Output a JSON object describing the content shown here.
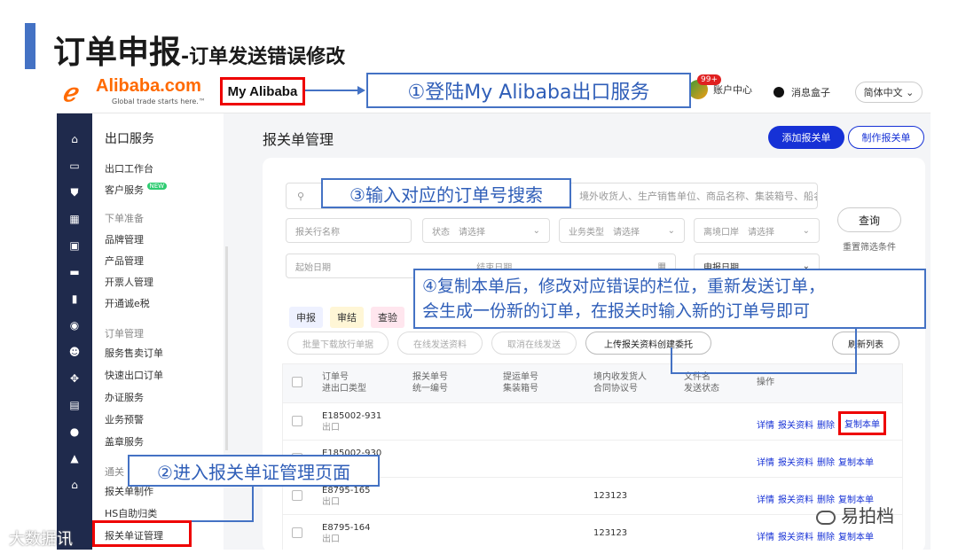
{
  "slide": {
    "title": "订单申报",
    "subtitle": "-订单发送错误修改"
  },
  "header": {
    "logo_text": "Alibaba.com",
    "logo_tagline": "Global trade starts here.™",
    "my_alibaba": "My Alibaba",
    "badge": "99+",
    "account_center": "账户中心",
    "message_box": "消息盒子",
    "language": "简体中文 ⌄"
  },
  "sidebar": {
    "title": "出口服务",
    "items": [
      {
        "label": "出口工作台"
      },
      {
        "label": "客户服务",
        "tag": "NEW"
      },
      {
        "group": "下单准备"
      },
      {
        "label": "品牌管理"
      },
      {
        "label": "产品管理"
      },
      {
        "label": "开票人管理"
      },
      {
        "label": "开通诚e税"
      },
      {
        "group": "订单管理"
      },
      {
        "label": "服务售卖订单"
      },
      {
        "label": "快速出口订单"
      },
      {
        "label": "办证服务"
      },
      {
        "label": "业务预警"
      },
      {
        "label": "盖章服务"
      },
      {
        "group": "通关"
      },
      {
        "label": "报关单制作"
      },
      {
        "label": "HS自助归类"
      },
      {
        "label": "报关单证管理"
      }
    ]
  },
  "main": {
    "page_title": "报关单管理",
    "add_button": "添加报关单",
    "make_button": "制作报关单",
    "search_placeholder": "境外收货人、生产销售单位、商品名称、集装箱号、船名&",
    "filters": {
      "declarer_placeholder": "报关行名称",
      "status_label": "状态",
      "status_value": "请选择",
      "biz_label": "业务类型",
      "biz_value": "请选择",
      "port_label": "离境口岸",
      "port_value": "请选择",
      "start_date": "起始日期",
      "end_date": "结束日期",
      "date_type": "申报日期"
    },
    "query_button": "查询",
    "reset_link": "重置筛选条件",
    "tabs": [
      "申报",
      "审结",
      "查验"
    ],
    "actions": [
      "批量下载放行单据",
      "在线发送资料",
      "取消在线发送",
      "上传报关资料创建委托",
      "刷新列表"
    ],
    "table": {
      "headers": [
        "订单号\n进出口类型",
        "报关单号\n统一编号",
        "提运单号\n集装箱号",
        "境内收发货人\n合同协议号",
        "文件名\n发送状态",
        "操作"
      ],
      "rows": [
        {
          "order": "E185002-931",
          "type": "出口",
          "contract": ""
        },
        {
          "order": "E185002-930",
          "type": "出口",
          "contract": ""
        },
        {
          "order": "E8795-165",
          "type": "出口",
          "contract": "123123"
        },
        {
          "order": "E8795-164",
          "type": "出口",
          "contract": "123123"
        }
      ],
      "ops": [
        "详情",
        "报关资料",
        "删除",
        "复制本单"
      ]
    }
  },
  "callouts": {
    "step1": "①登陆My Alibaba出口服务",
    "step2": "②进入报关单证管理页面",
    "step3": "③输入对应的订单号搜索",
    "step4_line1": "④复制本单后，修改对应错误的栏位，重新发送订单，",
    "step4_line2": "会生成一份新的订单，在报关时输入新的订单号即可"
  },
  "watermarks": {
    "left": "大数据讯",
    "right": "易拍档"
  }
}
